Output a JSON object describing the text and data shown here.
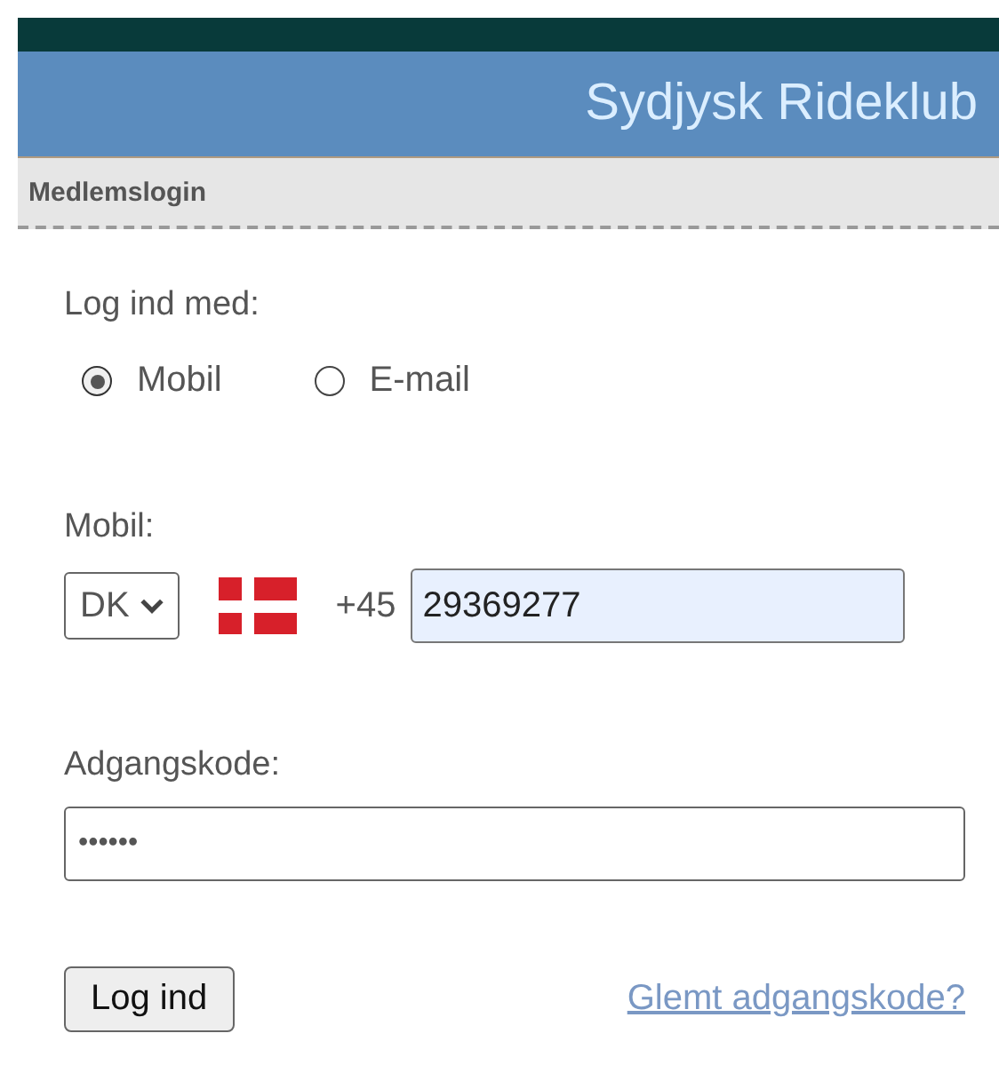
{
  "header": {
    "title": "Sydjysk Rideklub"
  },
  "section": {
    "title": "Medlemslogin"
  },
  "login_with": {
    "label": "Log ind med:",
    "options": [
      {
        "label": "Mobil",
        "selected": true
      },
      {
        "label": "E-mail",
        "selected": false
      }
    ]
  },
  "mobile": {
    "label": "Mobil:",
    "country": "DK",
    "prefix": "+45",
    "value": "29369277"
  },
  "password": {
    "label": "Adgangskode:",
    "value": "••••••"
  },
  "submit": "Log ind",
  "forgot_link": "Glemt adgangskode?"
}
